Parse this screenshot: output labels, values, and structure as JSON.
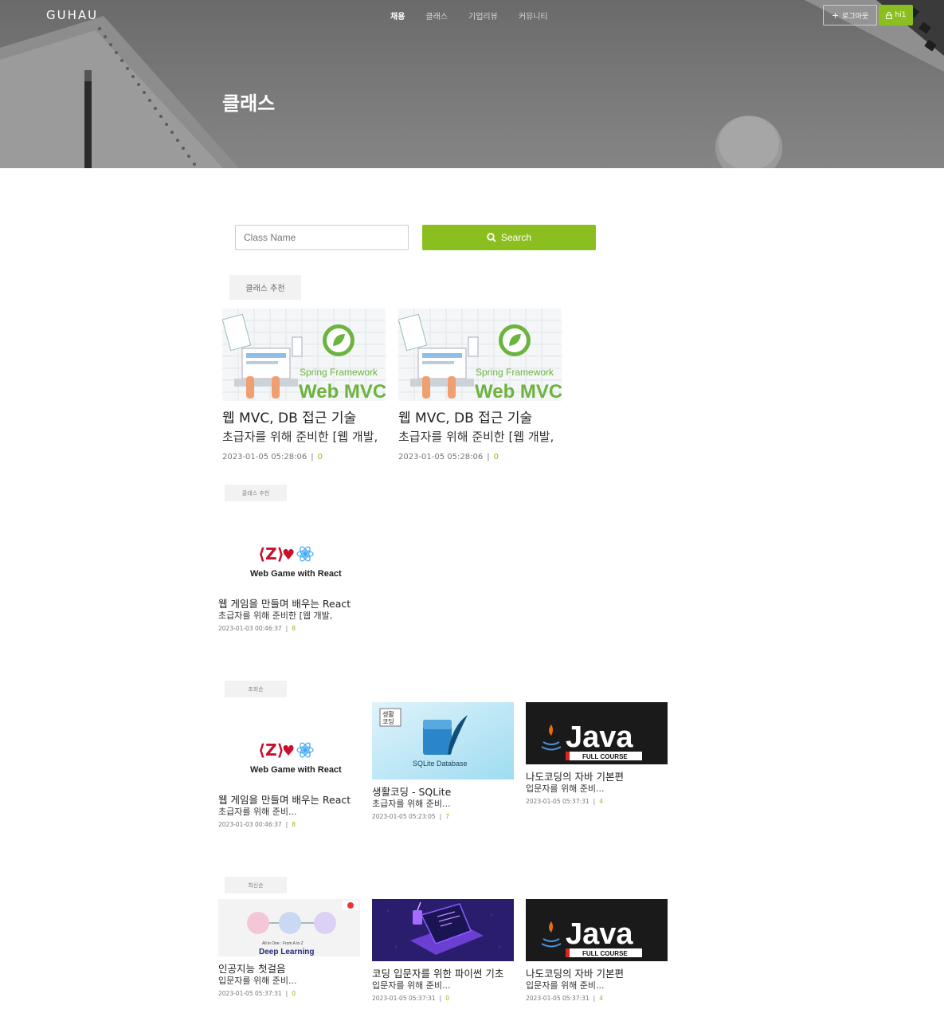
{
  "header": {
    "brand": "GUHAU",
    "nav": [
      "채용",
      "클래스",
      "기업리뷰",
      "커뮤니티"
    ],
    "logout_label": "로그아웃",
    "user_label": "hi1"
  },
  "hero": {
    "title": "클래스"
  },
  "search": {
    "placeholder": "Class Name",
    "button_label": "Search"
  },
  "sections": [
    {
      "tag": "클래스 추천",
      "cards": [
        {
          "thumb_text1": "Spring Framework",
          "thumb_text2": "Web MVC",
          "title": "웹 MVC, DB 접근 기술",
          "desc": "초급자를 위해 준비한 [웹 개발,",
          "date": "2023-01-05 05:28:06",
          "count": "0"
        },
        {
          "thumb_text1": "Spring Framework",
          "thumb_text2": "Web MVC",
          "title": "웹 MVC, DB 접근 기술",
          "desc": "초급자를 위해 준비한 [웹 개발,",
          "date": "2023-01-05 05:28:06",
          "count": "0"
        }
      ]
    },
    {
      "tag": "클래스 추천",
      "cards": [
        {
          "thumb_text": "Web Game with React",
          "title": "웹 게임을 만들며 배우는 React",
          "desc": "초급자를 위해 준비한 [웹 개발,",
          "date": "2023-01-03 00:46:37",
          "count": "8"
        }
      ]
    },
    {
      "tag": "조회순",
      "cards": [
        {
          "thumb_text": "Web Game with React",
          "title": "웹 게임을 만들며 배우는 React",
          "desc": "초급자를 위해 준비...",
          "date": "2023-01-03 00:46:37",
          "count": "8"
        },
        {
          "thumb_badge": "생활\n코딩",
          "thumb_text": "SQLite Database",
          "title": "생활코딩 - SQLite",
          "desc": "초급자를 위해 준비...",
          "date": "2023-01-05 05:23:05",
          "count": "7"
        },
        {
          "thumb_text": "Java",
          "thumb_sub": "FULL COURSE",
          "title": "나도코딩의 자바 기본편",
          "desc": "입문자를 위해 준비...",
          "date": "2023-01-05 05:37:31",
          "count": "4"
        }
      ]
    },
    {
      "tag": "최신순",
      "cards": [
        {
          "thumb_small": "All in One : From A to Z",
          "thumb_text": "Deep Learning",
          "title": "인공지능 첫걸음",
          "desc": "입문자를 위해 준비...",
          "date": "2023-01-05 05:37:31",
          "count": "0"
        },
        {
          "title": "코딩 입문자를 위한 파이썬 기초",
          "desc": "입문자를 위해 준비...",
          "date": "2023-01-05 05:37:31",
          "count": "0"
        },
        {
          "thumb_text": "Java",
          "thumb_sub": "FULL COURSE",
          "title": "나도코딩의 자바 기본편",
          "desc": "입문자를 위해 준비...",
          "date": "2023-01-05 05:37:31",
          "count": "4"
        }
      ]
    }
  ],
  "colors": {
    "accent": "#8bbf1f",
    "hero_bg": "#777777"
  }
}
